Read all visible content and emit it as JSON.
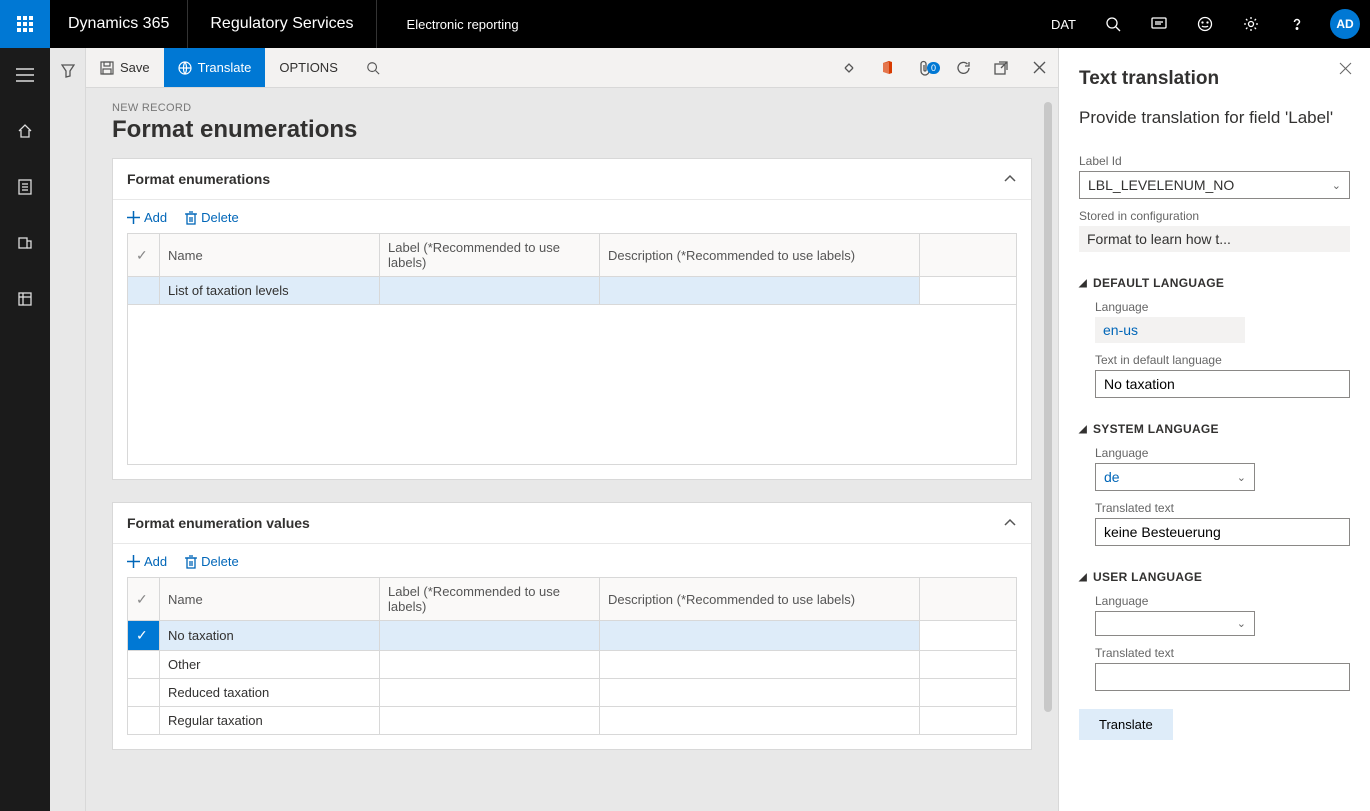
{
  "topbar": {
    "product": "Dynamics 365",
    "workspace": "Regulatory Services",
    "module": "Electronic reporting",
    "company": "DAT",
    "avatar": "AD"
  },
  "actionbar": {
    "save": "Save",
    "translate": "Translate",
    "options": "OPTIONS",
    "badge": "0"
  },
  "page": {
    "newrec": "NEW RECORD",
    "title": "Format enumerations"
  },
  "section1": {
    "title": "Format enumerations",
    "add": "Add",
    "delete": "Delete",
    "cols": {
      "name": "Name",
      "label": "Label (*Recommended to use labels)",
      "desc": "Description (*Recommended to use labels)"
    },
    "rows": [
      {
        "name": "List of taxation levels",
        "label": "",
        "desc": "",
        "selected": true
      }
    ]
  },
  "section2": {
    "title": "Format enumeration values",
    "add": "Add",
    "delete": "Delete",
    "cols": {
      "name": "Name",
      "label": "Label (*Recommended to use labels)",
      "desc": "Description (*Recommended to use labels)"
    },
    "rows": [
      {
        "name": "No taxation",
        "label": "",
        "desc": "",
        "selected": true
      },
      {
        "name": "Other",
        "label": "",
        "desc": "",
        "selected": false
      },
      {
        "name": "Reduced taxation",
        "label": "",
        "desc": "",
        "selected": false
      },
      {
        "name": "Regular taxation",
        "label": "",
        "desc": "",
        "selected": false
      }
    ]
  },
  "panel": {
    "title": "Text translation",
    "subtitle": "Provide translation for field 'Label'",
    "labelid_lbl": "Label Id",
    "labelid_val": "LBL_LEVELENUM_NO",
    "stored_lbl": "Stored in configuration",
    "stored_val": "Format to learn how t...",
    "def_head": "DEFAULT LANGUAGE",
    "def_lang_lbl": "Language",
    "def_lang_val": "en-us",
    "def_text_lbl": "Text in default language",
    "def_text_val": "No taxation",
    "sys_head": "SYSTEM LANGUAGE",
    "sys_lang_lbl": "Language",
    "sys_lang_val": "de",
    "sys_text_lbl": "Translated text",
    "sys_text_val": "keine Besteuerung",
    "usr_head": "USER LANGUAGE",
    "usr_lang_lbl": "Language",
    "usr_lang_val": "",
    "usr_text_lbl": "Translated text",
    "usr_text_val": "",
    "translate_btn": "Translate"
  }
}
